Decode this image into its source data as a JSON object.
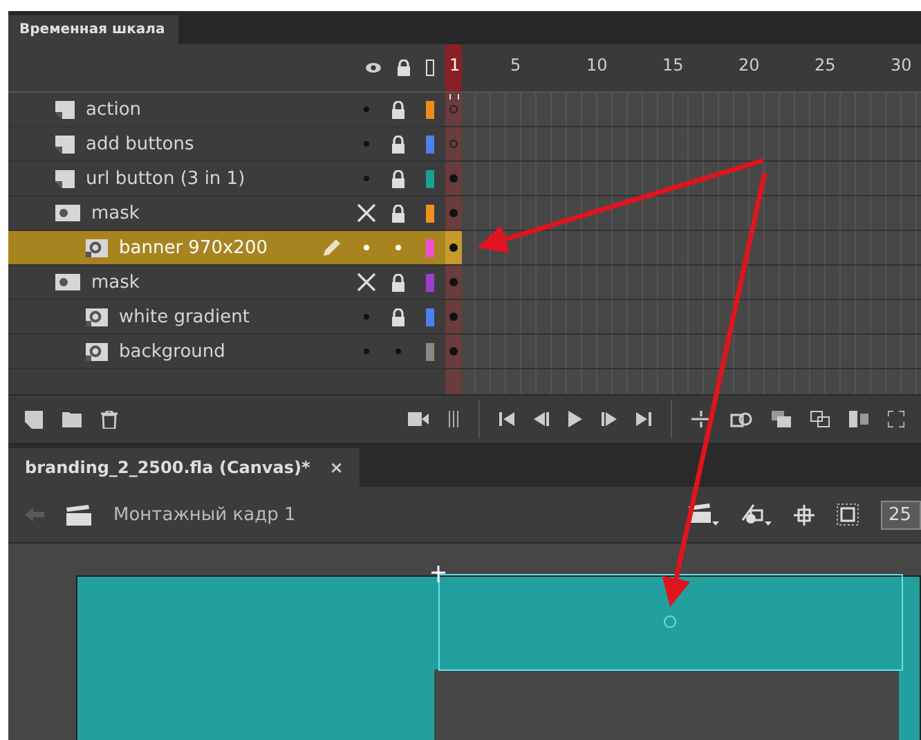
{
  "timeline": {
    "tab": "Временная шкала",
    "ruler": [
      "1",
      "5",
      "10",
      "15",
      "20",
      "25",
      "30"
    ],
    "layers": [
      {
        "name": "action",
        "kind": "normal",
        "visible": true,
        "locked": true,
        "color": "#f08c1e",
        "empty_keyframe": true,
        "script": true,
        "selected": false
      },
      {
        "name": "add buttons",
        "kind": "normal",
        "visible": true,
        "locked": true,
        "color": "#4f7ff0",
        "empty_keyframe": true,
        "script": false,
        "selected": false
      },
      {
        "name": "url button (3 in 1)",
        "kind": "normal",
        "visible": true,
        "locked": true,
        "color": "#16a394",
        "empty_keyframe": false,
        "script": false,
        "selected": false
      },
      {
        "name": "mask",
        "kind": "mask",
        "visible": false,
        "locked": true,
        "color": "#f0901e",
        "empty_keyframe": false,
        "script": false,
        "selected": false,
        "children": [
          {
            "name": "banner 970x200",
            "kind": "masked",
            "visible": true,
            "locked": false,
            "color": "#f050d0",
            "empty_keyframe": false,
            "script": false,
            "selected": true
          }
        ]
      },
      {
        "name": "mask",
        "kind": "mask",
        "visible": false,
        "locked": true,
        "color": "#9a3fd0",
        "empty_keyframe": false,
        "script": false,
        "selected": false,
        "children": [
          {
            "name": "white gradient",
            "kind": "masked",
            "visible": true,
            "locked": true,
            "color": "#4f7ff0",
            "empty_keyframe": false,
            "script": false,
            "selected": false
          },
          {
            "name": "background",
            "kind": "masked",
            "visible": true,
            "locked": false,
            "color": "#8a8a80",
            "empty_keyframe": false,
            "script": false,
            "selected": false
          }
        ]
      }
    ]
  },
  "document": {
    "tab": "branding_2_2500.fla (Canvas)*",
    "close": "×",
    "scene": "Монтажный кадр 1",
    "zoom": "25"
  }
}
